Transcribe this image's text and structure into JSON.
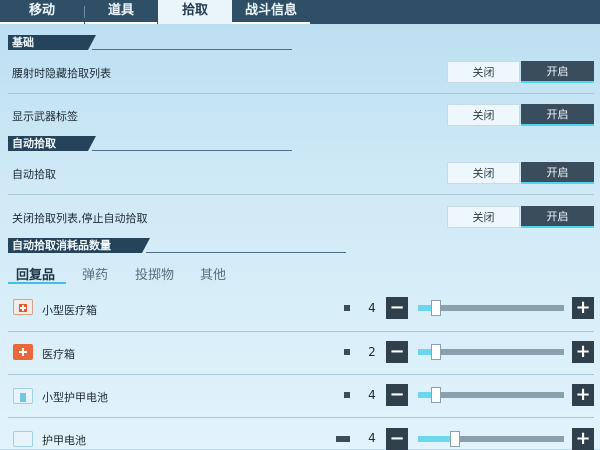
{
  "tabs": [
    {
      "label": "移动"
    },
    {
      "label": "道具"
    },
    {
      "label": "拾取"
    },
    {
      "label": "战斗信息"
    }
  ],
  "sections": {
    "basic": {
      "title": "基础"
    },
    "auto_pickup": {
      "title": "自动拾取"
    },
    "auto_consume": {
      "title": "自动拾取消耗品数量"
    }
  },
  "toggle_labels": {
    "off": "关闭",
    "on": "开启"
  },
  "settings": [
    {
      "label": "腰射时隐藏拾取列表",
      "state": "on"
    },
    {
      "label": "显示武器标签",
      "state": "on"
    },
    {
      "label": "自动拾取",
      "state": "on"
    },
    {
      "label": "关闭拾取列表,停止自动拾取",
      "state": "on"
    }
  ],
  "subtabs": [
    {
      "label": "回复品"
    },
    {
      "label": "弹药"
    },
    {
      "label": "投掷物"
    },
    {
      "label": "其他"
    }
  ],
  "items": [
    {
      "label": "小型医疗箱",
      "value": "4",
      "fill": 0.12
    },
    {
      "label": "医疗箱",
      "value": "2",
      "fill": 0.12
    },
    {
      "label": "小型护甲电池",
      "value": "4",
      "fill": 0.12
    },
    {
      "label": "护甲电池",
      "value": "4",
      "fill": 0.25
    }
  ],
  "colors": {
    "accent": "#4fd5ee",
    "header": "#25435a",
    "topbar": "#2f4f67"
  }
}
